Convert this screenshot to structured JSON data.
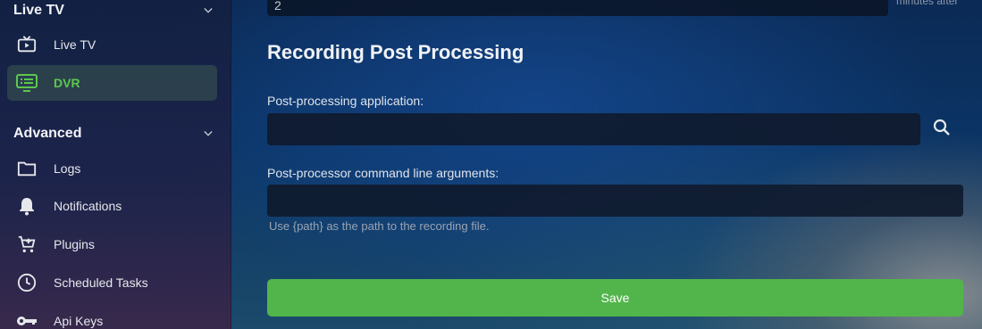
{
  "sidebar": {
    "sections": [
      {
        "title": "Live TV"
      },
      {
        "title": "Advanced"
      }
    ],
    "items": [
      {
        "label": "Live TV",
        "icon": "tv-icon"
      },
      {
        "label": "DVR",
        "icon": "dvr-icon",
        "active": true
      },
      {
        "label": "Logs",
        "icon": "folder-icon"
      },
      {
        "label": "Notifications",
        "icon": "bell-icon"
      },
      {
        "label": "Plugins",
        "icon": "cart-icon"
      },
      {
        "label": "Scheduled Tasks",
        "icon": "clock-icon"
      },
      {
        "label": "Api Keys",
        "icon": "key-icon"
      }
    ]
  },
  "main": {
    "top_input_value": "2",
    "top_input_suffix": "minutes after",
    "section_title": "Recording Post Processing",
    "post_app": {
      "label": "Post-processing application:",
      "value": "",
      "search_icon": "search-icon"
    },
    "post_args": {
      "label": "Post-processor command line arguments:",
      "value": "",
      "hint": "Use {path} as the path to the recording file."
    },
    "save_label": "Save"
  },
  "colors": {
    "accent": "#52b54b",
    "active_text": "#5cc84e"
  }
}
